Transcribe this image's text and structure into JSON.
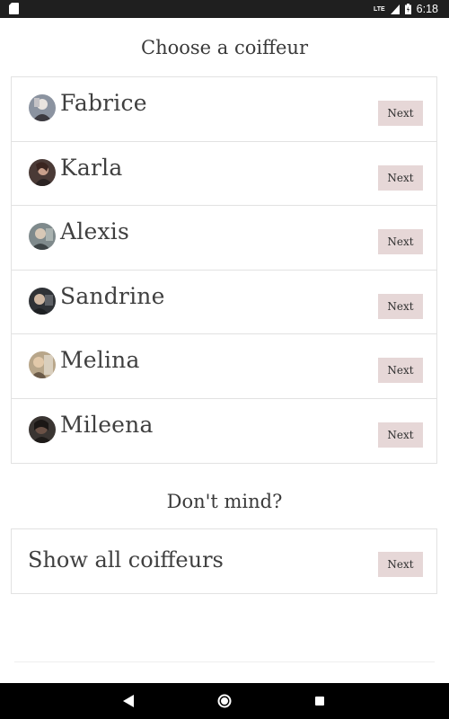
{
  "status_bar": {
    "network": "LTE",
    "time": "6:18",
    "icons": [
      "sd-card-icon",
      "signal-icon",
      "battery-icon"
    ]
  },
  "main": {
    "title": "Choose a coiffeur",
    "coiffeurs": [
      {
        "name": "Fabrice",
        "next_label": "Next"
      },
      {
        "name": "Karla",
        "next_label": "Next"
      },
      {
        "name": "Alexis",
        "next_label": "Next"
      },
      {
        "name": "Sandrine",
        "next_label": "Next"
      },
      {
        "name": "Melina",
        "next_label": "Next"
      },
      {
        "name": "Mileena",
        "next_label": "Next"
      }
    ],
    "dont_mind_title": "Don't mind?",
    "show_all": {
      "label": "Show all coiffeurs",
      "next_label": "Next"
    }
  },
  "colors": {
    "next_button_bg": "#e6d7d7",
    "border": "#e2e2e2",
    "text": "#3a3a3a",
    "status_bar_bg": "#1f1f1f",
    "nav_bar_bg": "#000000"
  },
  "nav_bar": {
    "icons": [
      "back-icon",
      "home-icon",
      "recents-icon"
    ]
  }
}
